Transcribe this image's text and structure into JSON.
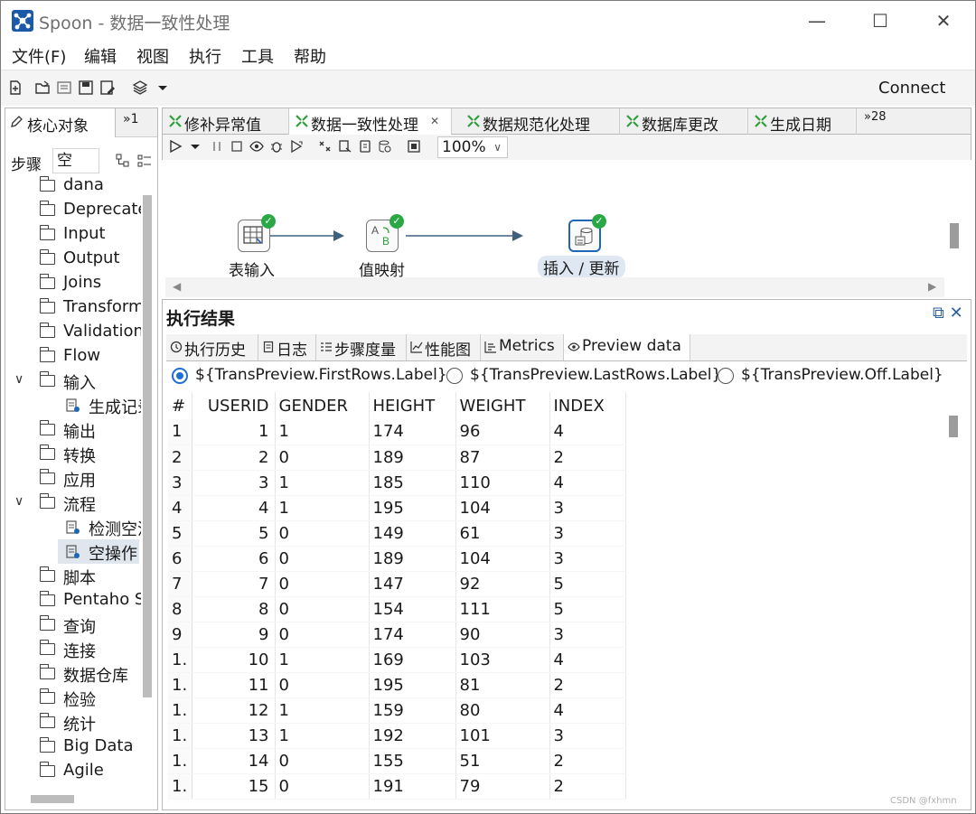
{
  "window": {
    "title": "Spoon - 数据一致性处理",
    "min_glyph": "—",
    "max_glyph": "☐",
    "close_glyph": "✕"
  },
  "menu": [
    "文件(F)",
    "编辑",
    "视图",
    "执行",
    "工具",
    "帮助"
  ],
  "toolbar": {
    "connect_label": "Connect"
  },
  "left_panel": {
    "tab_label": "核心对象",
    "tab_overflow": "»1",
    "steps_label": "步骤",
    "search_value": "空",
    "tree": [
      {
        "label": "dana",
        "level": 0,
        "expanded": false,
        "type": "folder"
      },
      {
        "label": "Deprecated",
        "level": 0,
        "expanded": false,
        "type": "folder"
      },
      {
        "label": "Input",
        "level": 0,
        "expanded": false,
        "type": "folder"
      },
      {
        "label": "Output",
        "level": 0,
        "expanded": false,
        "type": "folder"
      },
      {
        "label": "Joins",
        "level": 0,
        "expanded": false,
        "type": "folder"
      },
      {
        "label": "Transform",
        "level": 0,
        "expanded": false,
        "type": "folder"
      },
      {
        "label": "Validation",
        "level": 0,
        "expanded": false,
        "type": "folder"
      },
      {
        "label": "Flow",
        "level": 0,
        "expanded": false,
        "type": "folder"
      },
      {
        "label": "输入",
        "level": 0,
        "expanded": true,
        "type": "folder"
      },
      {
        "label": "生成记录",
        "level": 1,
        "type": "step"
      },
      {
        "label": "输出",
        "level": 0,
        "expanded": false,
        "type": "folder"
      },
      {
        "label": "转换",
        "level": 0,
        "expanded": false,
        "type": "folder"
      },
      {
        "label": "应用",
        "level": 0,
        "expanded": false,
        "type": "folder"
      },
      {
        "label": "流程",
        "level": 0,
        "expanded": true,
        "type": "folder"
      },
      {
        "label": "检测空流",
        "level": 1,
        "type": "step"
      },
      {
        "label": "空操作",
        "level": 1,
        "type": "step",
        "selected": true
      },
      {
        "label": "脚本",
        "level": 0,
        "expanded": false,
        "type": "folder"
      },
      {
        "label": "Pentaho Server",
        "level": 0,
        "expanded": false,
        "type": "folder"
      },
      {
        "label": "查询",
        "level": 0,
        "expanded": false,
        "type": "folder"
      },
      {
        "label": "连接",
        "level": 0,
        "expanded": false,
        "type": "folder"
      },
      {
        "label": "数据仓库",
        "level": 0,
        "expanded": false,
        "type": "folder"
      },
      {
        "label": "检验",
        "level": 0,
        "expanded": false,
        "type": "folder"
      },
      {
        "label": "统计",
        "level": 0,
        "expanded": false,
        "type": "folder"
      },
      {
        "label": "Big Data",
        "level": 0,
        "expanded": false,
        "type": "folder"
      },
      {
        "label": "Agile",
        "level": 0,
        "expanded": false,
        "type": "folder"
      }
    ]
  },
  "doc_tabs": [
    {
      "label": "修补异常值",
      "active": false
    },
    {
      "label": "数据一致性处理",
      "active": true,
      "closable": true
    },
    {
      "label": "数据规范化处理",
      "active": false
    },
    {
      "label": "数据库更改",
      "active": false
    },
    {
      "label": "生成日期",
      "active": false
    }
  ],
  "doc_tabs_overflow": "»28",
  "canvas_toolbar": {
    "zoom": "100%"
  },
  "canvas": {
    "nodes": [
      {
        "label": "表输入",
        "icon": "table-input-icon"
      },
      {
        "label": "值映射",
        "icon": "value-mapper-icon"
      },
      {
        "label": "插入 / 更新",
        "icon": "insert-update-icon",
        "selected": true
      }
    ]
  },
  "results": {
    "title": "执行结果",
    "tabs": [
      {
        "label": "执行历史",
        "icon": "history-icon"
      },
      {
        "label": "日志",
        "icon": "log-icon"
      },
      {
        "label": "步骤度量",
        "icon": "step-metrics-icon"
      },
      {
        "label": "性能图",
        "icon": "performance-icon"
      },
      {
        "label": "Metrics",
        "icon": "metrics-icon"
      },
      {
        "label": "Preview data",
        "icon": "eye-icon",
        "active": true
      }
    ],
    "radios": [
      {
        "label": "${TransPreview.FirstRows.Label}",
        "checked": true
      },
      {
        "label": "${TransPreview.LastRows.Label}",
        "checked": false
      },
      {
        "label": "${TransPreview.Off.Label}",
        "checked": false
      }
    ],
    "columns": [
      "#",
      "USERID",
      "GENDER",
      "HEIGHT",
      "WEIGHT",
      "INDEX"
    ],
    "rows": [
      [
        "1",
        "1",
        "1",
        "174",
        "96",
        "4"
      ],
      [
        "2",
        "2",
        "0",
        "189",
        "87",
        "2"
      ],
      [
        "3",
        "3",
        "1",
        "185",
        "110",
        "4"
      ],
      [
        "4",
        "4",
        "1",
        "195",
        "104",
        "3"
      ],
      [
        "5",
        "5",
        "0",
        "149",
        "61",
        "3"
      ],
      [
        "6",
        "6",
        "0",
        "189",
        "104",
        "3"
      ],
      [
        "7",
        "7",
        "0",
        "147",
        "92",
        "5"
      ],
      [
        "8",
        "8",
        "0",
        "154",
        "111",
        "5"
      ],
      [
        "9",
        "9",
        "0",
        "174",
        "90",
        "3"
      ],
      [
        "1.",
        "10",
        "1",
        "169",
        "103",
        "4"
      ],
      [
        "1.",
        "11",
        "0",
        "195",
        "81",
        "2"
      ],
      [
        "1.",
        "12",
        "1",
        "159",
        "80",
        "4"
      ],
      [
        "1.",
        "13",
        "1",
        "192",
        "101",
        "3"
      ],
      [
        "1.",
        "14",
        "0",
        "155",
        "51",
        "2"
      ],
      [
        "1.",
        "15",
        "0",
        "191",
        "79",
        "2"
      ]
    ]
  },
  "watermark": "CSDN @fxhmn"
}
